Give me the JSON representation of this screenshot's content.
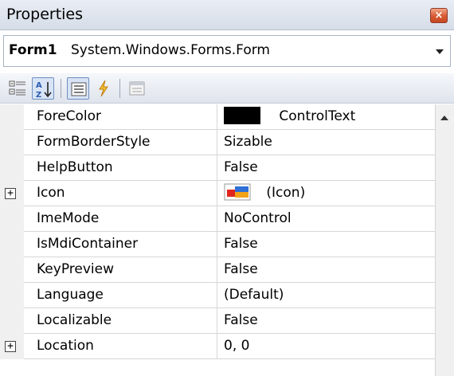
{
  "window": {
    "title": "Properties",
    "close_glyph": "×",
    "close_icon": "close-icon"
  },
  "object_selector": {
    "name": "Form1",
    "type": "System.Windows.Forms.Form",
    "dropdown_icon": "chevron-down-icon"
  },
  "toolbar": {
    "buttons": [
      {
        "icon": "categorized-icon",
        "active": false
      },
      {
        "icon": "alphabetical-icon",
        "active": true
      },
      {
        "icon": "properties-icon",
        "active": true
      },
      {
        "icon": "events-icon",
        "active": false
      },
      {
        "icon": "property-pages-icon",
        "active": false
      }
    ]
  },
  "colors": {
    "forecolor_swatch": "#000000",
    "icon_red": "#e0261c",
    "icon_blue": "#2f6fd6",
    "icon_orange": "#f3a21a"
  },
  "properties": [
    {
      "name": "ForeColor",
      "value": "ControlText",
      "expandable": false
    },
    {
      "name": "FormBorderStyle",
      "value": "Sizable",
      "expandable": false
    },
    {
      "name": "HelpButton",
      "value": "False",
      "expandable": false
    },
    {
      "name": "Icon",
      "value": "(Icon)",
      "expandable": true
    },
    {
      "name": "ImeMode",
      "value": "NoControl",
      "expandable": false
    },
    {
      "name": "IsMdiContainer",
      "value": "False",
      "expandable": false
    },
    {
      "name": "KeyPreview",
      "value": "False",
      "expandable": false
    },
    {
      "name": "Language",
      "value": "(Default)",
      "expandable": false
    },
    {
      "name": "Localizable",
      "value": "False",
      "expandable": false
    },
    {
      "name": "Location",
      "value": "0, 0",
      "expandable": true
    }
  ],
  "expander_glyph": "+"
}
